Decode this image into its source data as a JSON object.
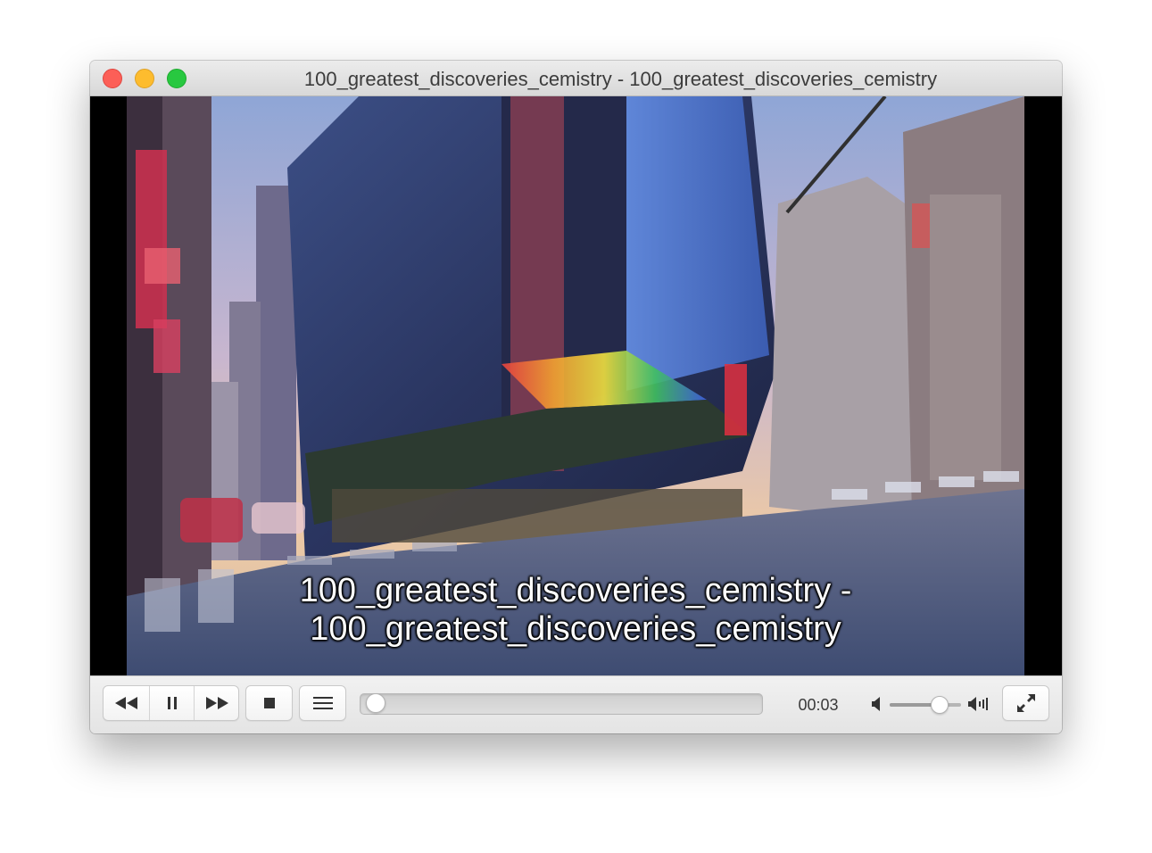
{
  "window": {
    "title": "100_greatest_discoveries_cemistry - 100_greatest_discoveries_cemistry"
  },
  "video": {
    "subtitle_line1": "100_greatest_discoveries_cemistry -",
    "subtitle_line2": "100_greatest_discoveries_cemistry"
  },
  "controls": {
    "rewind_icon": "rewind-icon",
    "pause_icon": "pause-icon",
    "forward_icon": "fast-forward-icon",
    "stop_icon": "stop-icon",
    "playlist_icon": "playlist-icon",
    "fullscreen_icon": "fullscreen-icon",
    "time_elapsed": "00:03",
    "playback_progress": 0.01,
    "volume_level": 0.7
  },
  "colors": {
    "close": "#fc5f57",
    "minimize": "#fdbc2e",
    "zoom": "#28c840"
  }
}
